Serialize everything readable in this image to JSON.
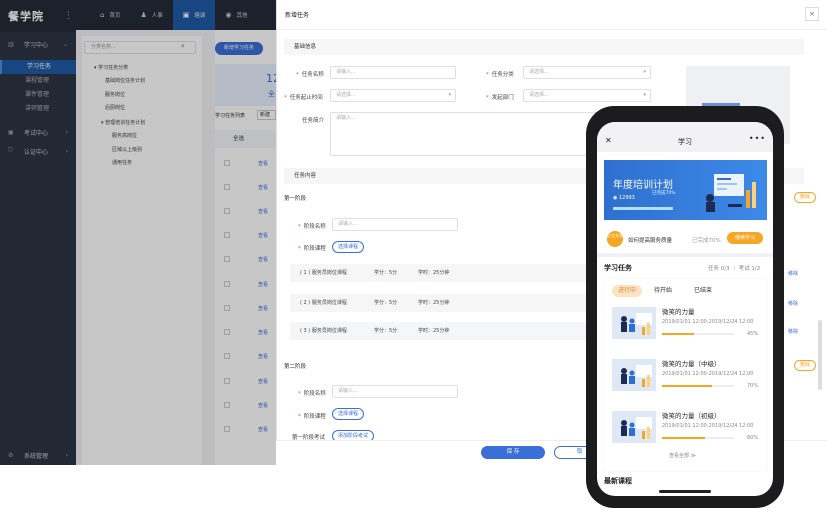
{
  "sidebar": {
    "logo": "餐学院",
    "hamburger": "⋮",
    "groups": [
      {
        "label": "学习中心",
        "icon": "▥",
        "chevron": "⌄"
      },
      {
        "label": "考试中心",
        "icon": "▣",
        "chevron": "›"
      },
      {
        "label": "认证中心",
        "icon": "⛉",
        "chevron": "›"
      }
    ],
    "sub_items": [
      "学习任务",
      "课程管理",
      "课件管理",
      "讲师管理"
    ],
    "footer": {
      "label": "系统管理",
      "icon": "⚙",
      "chevron": "›"
    }
  },
  "topnav": {
    "items": [
      {
        "label": "首页",
        "icon": "⌂"
      },
      {
        "label": "人事",
        "icon": "♟"
      },
      {
        "label": "培训",
        "icon": "▣"
      },
      {
        "label": "其他",
        "icon": "◉"
      }
    ]
  },
  "bgpage": {
    "search_placeholder": "分类名称...",
    "search_icon": "⌕",
    "tree": [
      "▾ 学习任务分类",
      "基础岗位任务计划",
      "服务岗位",
      "后厨岗位",
      "▾ 管理培训任务计划",
      "服务高岗位",
      "区域以上级别",
      "通用任务"
    ],
    "add_button": "新增学习任务",
    "stat_number": "12",
    "stat_sub": "全",
    "table_title": "学习任务列表",
    "table_button": "新建",
    "table_header": "全选",
    "view_label": "查看"
  },
  "drawer": {
    "title": "新增任务",
    "close": "×",
    "basic_section": "基础信息",
    "fields": {
      "task_name": {
        "label": "任务名称",
        "placeholder": "请输入..."
      },
      "task_category": {
        "label": "任务分类",
        "placeholder": "请选择..."
      },
      "period": {
        "label": "任务起止时间",
        "placeholder": "请选择..."
      },
      "dept": {
        "label": "发起部门",
        "placeholder": "请选择..."
      },
      "intro": {
        "label": "任务简介",
        "placeholder": "请输入..."
      }
    },
    "content_section": "任务内容",
    "stage1": {
      "title": "第一阶段",
      "delete": "删除",
      "name_label": "阶段名称",
      "name_placeholder": "请输入...",
      "course_label": "阶段课程",
      "choose_course": "选择课程",
      "courses": [
        {
          "name": "( 1 ) 服务员岗位课程",
          "credit": "学分：5分",
          "hours": "学时：25分钟",
          "remove": "移除"
        },
        {
          "name": "( 2 ) 服务员岗位课程",
          "credit": "学分：5分",
          "hours": "学时：25分钟",
          "remove": "移除"
        },
        {
          "name": "( 3 ) 服务员岗位课程",
          "credit": "学分：5分",
          "hours": "学时：25分钟",
          "remove": "移除"
        }
      ]
    },
    "stage2": {
      "title": "第二阶段",
      "delete": "删除",
      "name_label": "阶段名称",
      "name_placeholder": "请输入...",
      "course_label": "阶段课程",
      "choose_course": "选择课程",
      "exam_label": "第一阶段考试",
      "add_exam": "添加阶段考试"
    },
    "save": "保 存",
    "cancel": "取"
  },
  "phone": {
    "title": "学习",
    "back": "✕",
    "more": "•••",
    "banner": {
      "title": "年度培训计划",
      "progress": "已完成70%",
      "views": "◉ 12993"
    },
    "tip": {
      "badge": "企业文化",
      "text": "如何提高服务质量",
      "progress": "已完成70%",
      "button": "继续学习"
    },
    "learn": {
      "title": "学习任务",
      "stats": "任务 0/3 ｜ 考试 1/2"
    },
    "tabs": [
      "进行中",
      "待开始",
      "已结束"
    ],
    "tasks": [
      {
        "name": "微笑的力量",
        "date": "2019/01/01 12:00-2019/12/24 12:00",
        "progress": 45,
        "pct": "45%"
      },
      {
        "name": "微笑的力量（中级）",
        "date": "2019/01/01 12:00-2019/12/24 12:00",
        "progress": 70,
        "pct": "70%"
      },
      {
        "name": "微笑的力量（初级）",
        "date": "2019/01/01 12:00-2019/12/24 12:00",
        "progress": 60,
        "pct": "60%"
      }
    ],
    "view_all": "查看全部 ≫",
    "latest": "最新课程"
  }
}
